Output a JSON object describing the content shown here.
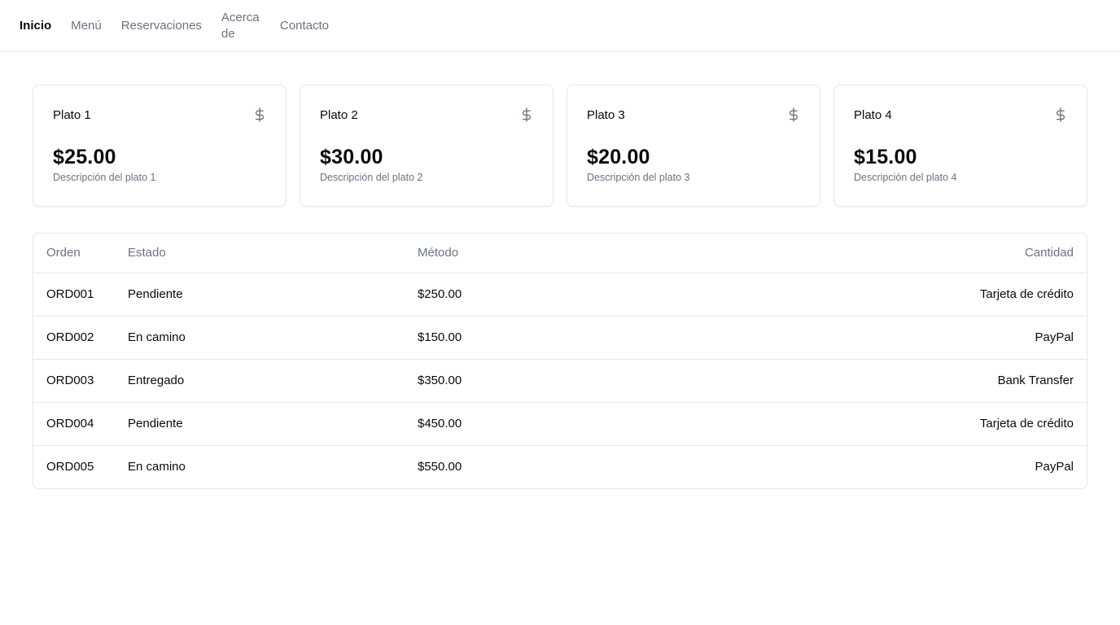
{
  "nav": {
    "items": [
      {
        "label": "Inicio"
      },
      {
        "label": "Menú"
      },
      {
        "label": "Reservaciones"
      },
      {
        "label": "Acerca de"
      },
      {
        "label": "Contacto"
      }
    ],
    "active": "Inicio"
  },
  "cards": [
    {
      "title": "Plato 1",
      "price": "$25.00",
      "description": "Descripción del plato 1",
      "icon": "dollar-sign-icon"
    },
    {
      "title": "Plato 2",
      "price": "$30.00",
      "description": "Descripción del plato 2",
      "icon": "dollar-sign-icon"
    },
    {
      "title": "Plato 3",
      "price": "$20.00",
      "description": "Descripción del plato 3",
      "icon": "dollar-sign-icon"
    },
    {
      "title": "Plato 4",
      "price": "$15.00",
      "description": "Descripción del plato 4",
      "icon": "dollar-sign-icon"
    }
  ],
  "table": {
    "headers": [
      "Orden",
      "Estado",
      "Método",
      "Cantidad"
    ],
    "rows": [
      {
        "orden": "ORD001",
        "estado": "Pendiente",
        "metodo": "$250.00",
        "cantidad": "Tarjeta de crédito"
      },
      {
        "orden": "ORD002",
        "estado": "En camino",
        "metodo": "$150.00",
        "cantidad": "PayPal"
      },
      {
        "orden": "ORD003",
        "estado": "Entregado",
        "metodo": "$350.00",
        "cantidad": "Bank Transfer"
      },
      {
        "orden": "ORD004",
        "estado": "Pendiente",
        "metodo": "$450.00",
        "cantidad": "Tarjeta de crédito"
      },
      {
        "orden": "ORD005",
        "estado": "En camino",
        "metodo": "$550.00",
        "cantidad": "PayPal"
      }
    ]
  },
  "colors": {
    "text": "#0a0a0a",
    "muted": "#6b7280",
    "border": "#e5e7eb"
  }
}
